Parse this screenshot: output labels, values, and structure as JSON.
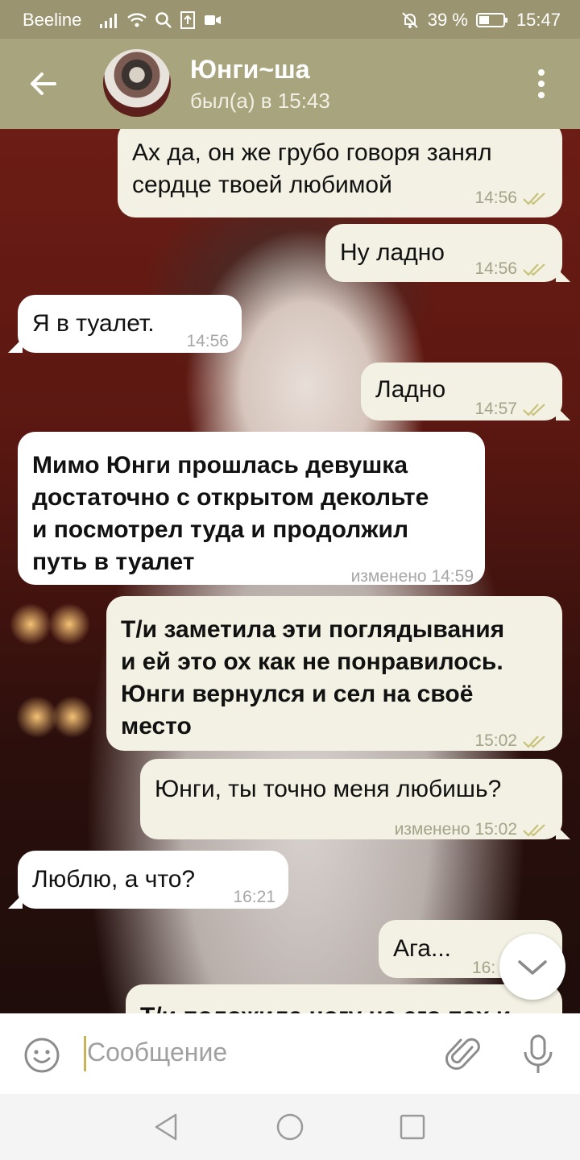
{
  "status_bar": {
    "carrier": "Beeline",
    "battery": "39 %",
    "time": "15:47"
  },
  "header": {
    "contact_name": "Юнги~ша",
    "last_seen": "был(а) в 15:43"
  },
  "messages": [
    {
      "direction": "out",
      "text_lines": [
        "Ах да, он же грубо говоря занял",
        "сердце твоей любимой"
      ],
      "time": "14:56",
      "read": true
    },
    {
      "direction": "out",
      "text_lines": [
        "Ну ладно"
      ],
      "time": "14:56",
      "read": true
    },
    {
      "direction": "in",
      "text_lines": [
        "Я в туалет."
      ],
      "time": "14:56"
    },
    {
      "direction": "out",
      "text_lines": [
        "Ладно"
      ],
      "time": "14:57",
      "read": true
    },
    {
      "direction": "in",
      "bold": true,
      "text_lines": [
        "Мимо Юнги прошлась девушка",
        "достаточно с открытом декольте",
        "и посмотрел туда и продолжил",
        "путь в туалет"
      ],
      "time": "изменено 14:59"
    },
    {
      "direction": "out",
      "bold": true,
      "text_lines": [
        "Т/и заметила эти поглядывания",
        "и ей это ох как не понравилось.",
        "Юнги вернулся и сел на своё",
        "место"
      ],
      "time": "15:02",
      "read": true
    },
    {
      "direction": "out",
      "text_lines": [
        "Юнги, ты точно меня любишь?"
      ],
      "time": "изменено 15:02",
      "read": true
    },
    {
      "direction": "in",
      "text_lines": [
        "Люблю, а что?"
      ],
      "time": "16:21"
    },
    {
      "direction": "out",
      "text_lines": [
        "Ага..."
      ],
      "time": "16:",
      "read": true
    },
    {
      "direction": "out",
      "bold": true,
      "text_lines": [
        "Т/и положила ногу на его пах и"
      ],
      "partial": true
    }
  ],
  "input": {
    "placeholder": "Сообщение"
  },
  "colors": {
    "header_bg": "#a8a47d",
    "status_bg": "#9a9570",
    "outgoing_bubble": "#f2f1e3",
    "incoming_bubble": "#ffffff",
    "check_color": "#c9c27a"
  },
  "icons": {
    "back": "arrow-left-icon",
    "menu": "more-vertical-icon",
    "emoji": "smiley-icon",
    "attach": "paperclip-icon",
    "mic": "microphone-icon",
    "scroll": "chevron-down-icon",
    "nav_back": "triangle-back-icon",
    "nav_home": "circle-home-icon",
    "nav_recent": "square-recent-icon"
  }
}
